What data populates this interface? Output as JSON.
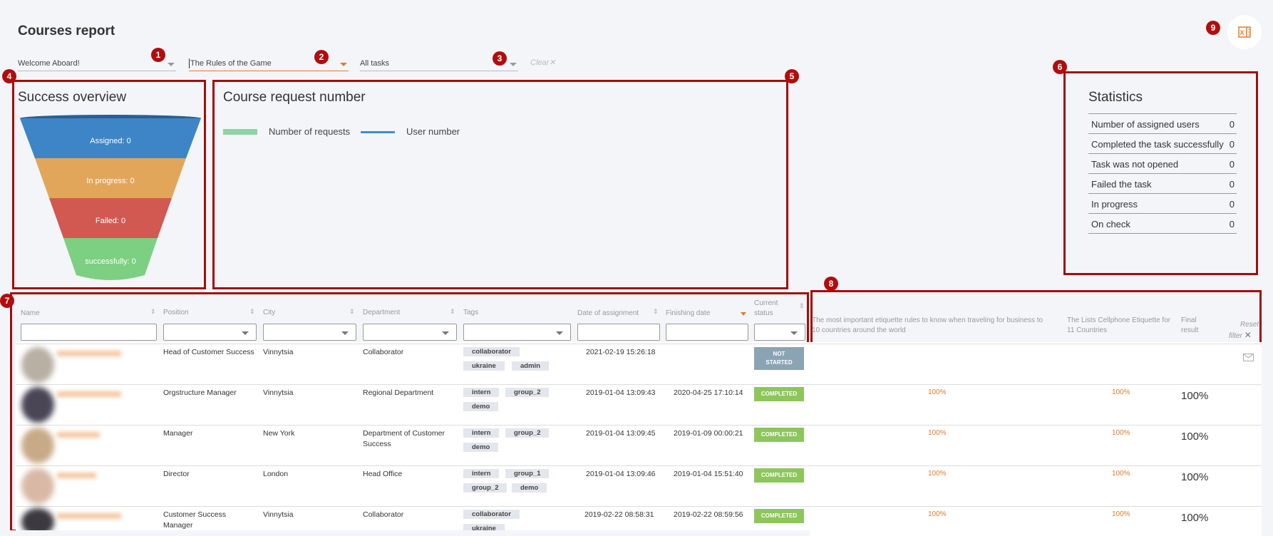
{
  "title": "Courses report",
  "filters": {
    "course": "Welcome Aboard!",
    "task": "The Rules of the Game",
    "scope": "All tasks",
    "clear_label": "Clear"
  },
  "badges": [
    "1",
    "2",
    "3",
    "4",
    "5",
    "6",
    "7",
    "8",
    "9"
  ],
  "success_overview": {
    "title": "Success overview",
    "stages": [
      {
        "label": "Assigned: 0",
        "color": "#3d85c6"
      },
      {
        "label": "In progress: 0",
        "color": "#e2a65a"
      },
      {
        "label": "Failed: 0",
        "color": "#d25852"
      },
      {
        "label": "successfully: 0",
        "color": "#7dcf82"
      }
    ]
  },
  "course_requests": {
    "title": "Course request number",
    "legend": [
      {
        "label": "Number of requests",
        "color": "#8dd3a5"
      },
      {
        "label": "User number",
        "color": "#3f8fc4"
      }
    ]
  },
  "statistics": {
    "title": "Statistics",
    "rows": [
      {
        "label": "Number of assigned users",
        "value": "0"
      },
      {
        "label": "Completed the task successfully",
        "value": "0"
      },
      {
        "label": "Task was not opened",
        "value": "0"
      },
      {
        "label": "Failed the task",
        "value": "0"
      },
      {
        "label": "In progress",
        "value": "0"
      },
      {
        "label": "On check",
        "value": "0"
      }
    ]
  },
  "table": {
    "headers": {
      "name": "Name",
      "position": "Position",
      "city": "City",
      "department": "Department",
      "tags": "Tags",
      "date_assigned": "Date of assignment",
      "finishing_date": "Finishing date",
      "status_1": "Current",
      "status_2": "status",
      "etiquette_1": "The most important etiquette rules to know when traveling for business to",
      "etiquette_2": "10 countries around the world",
      "cellphone_1": "The Lists Cellphone Etiquette for",
      "cellphone_2": "11 Countries",
      "final_1": "Final",
      "final_2": "result",
      "reset_1": "Reset",
      "reset_2": "filter"
    },
    "rows": [
      {
        "position": "Head of Customer Success",
        "city": "Vinnytsia",
        "department": "Collaborator",
        "department_2": "",
        "tags": [
          "collaborator",
          "ukraine",
          "admin"
        ],
        "date_assigned": "2021-02-19 15:26:18",
        "finishing_date": "",
        "status": "NOT STARTED",
        "status_1": "NOT",
        "status_2": "STARTED",
        "etiquette": "",
        "cellphone": "",
        "final": ""
      },
      {
        "position": "Orgstructure Manager",
        "city": "Vinnytsia",
        "department": "Regional Department",
        "department_2": "",
        "tags": [
          "intern",
          "group_2",
          "demo"
        ],
        "date_assigned": "2019-01-04 13:09:43",
        "finishing_date": "2020-04-25 17:10:14",
        "status": "COMPLETED",
        "etiquette": "100%",
        "cellphone": "100%",
        "final": "100%"
      },
      {
        "position": "Manager",
        "city": "New York",
        "department": "Department of Customer",
        "department_2": "Success",
        "tags": [
          "intern",
          "group_2",
          "demo"
        ],
        "date_assigned": "2019-01-04 13:09:45",
        "finishing_date": "2019-01-09 00:00:21",
        "status": "COMPLETED",
        "etiquette": "100%",
        "cellphone": "100%",
        "final": "100%"
      },
      {
        "position": "Director",
        "city": "London",
        "department": "Head Office",
        "department_2": "",
        "tags": [
          "intern",
          "group_1",
          "group_2",
          "demo"
        ],
        "date_assigned": "2019-01-04 13:09:46",
        "finishing_date": "2019-01-04 15:51:40",
        "status": "COMPLETED",
        "etiquette": "100%",
        "cellphone": "100%",
        "final": "100%"
      },
      {
        "position": "Customer Success",
        "position_2": "Manager",
        "city": "Vinnytsia",
        "department": "Collaborator",
        "department_2": "",
        "tags": [
          "collaborator",
          "ukraine"
        ],
        "date_assigned": "2019-02-22 08:58:31",
        "finishing_date": "2019-02-22 08:59:56",
        "status": "COMPLETED",
        "etiquette": "100%",
        "cellphone": "100%",
        "final": "100%"
      }
    ]
  },
  "colors": {
    "annotation": "#a10d0d",
    "accent": "#e07b2a",
    "completed": "#8dc65a",
    "not_started": "#8aa4b4"
  }
}
